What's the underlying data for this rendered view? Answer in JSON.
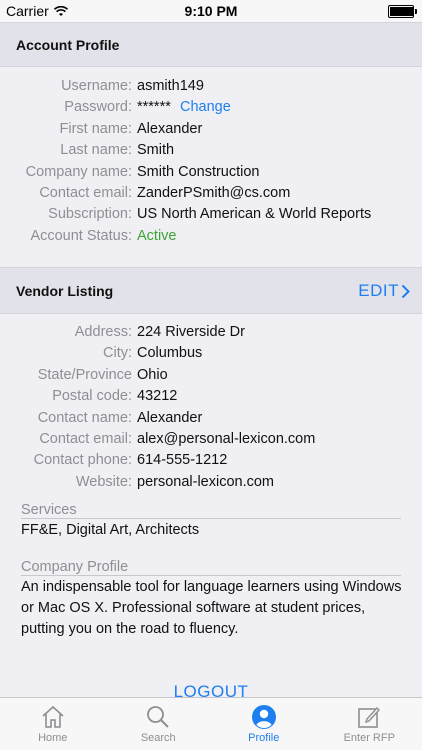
{
  "status_bar": {
    "carrier": "Carrier",
    "time": "9:10 PM",
    "battery_level": 0.95
  },
  "account_profile": {
    "title": "Account Profile",
    "fields": [
      {
        "label": "Username:",
        "value": "asmith149"
      },
      {
        "label": "Password:",
        "value": "******",
        "action": "Change"
      },
      {
        "label": "First name:",
        "value": "Alexander"
      },
      {
        "label": "Last name:",
        "value": "Smith"
      },
      {
        "label": "Company name:",
        "value": "Smith Construction"
      },
      {
        "label": "Contact email:",
        "value": "ZanderPSmith@cs.com"
      },
      {
        "label": "Subscription:",
        "value": "US North American & World Reports"
      },
      {
        "label": "Account Status:",
        "value": "Active"
      }
    ]
  },
  "vendor_listing": {
    "title": "Vendor Listing",
    "edit_label": "EDIT",
    "fields": [
      {
        "label": "Address:",
        "value": "224 Riverside Dr"
      },
      {
        "label": "City:",
        "value": "Columbus"
      },
      {
        "label": "State/Province",
        "value": "Ohio"
      },
      {
        "label": "Postal code:",
        "value": "43212"
      },
      {
        "label": "Contact name:",
        "value": "Alexander"
      },
      {
        "label": "Contact email:",
        "value": "alex@personal-lexicon.com"
      },
      {
        "label": "Contact phone:",
        "value": "614-555-1212"
      },
      {
        "label": "Website:",
        "value": "personal-lexicon.com"
      }
    ],
    "services_label": "Services",
    "services_value": "FF&E, Digital Art, Architects",
    "company_profile_label": "Company Profile",
    "company_profile_value": "An indispensable tool for language learners using Windows or Mac OS X. Professional software at student prices, putting you on the road to fluency."
  },
  "logout_label": "LOGOUT",
  "tabs": [
    {
      "label": "Home",
      "icon": "home-icon"
    },
    {
      "label": "Search",
      "icon": "search-icon"
    },
    {
      "label": "Profile",
      "icon": "profile-icon",
      "selected": true
    },
    {
      "label": "Enter RFP",
      "icon": "compose-icon"
    }
  ],
  "colors": {
    "accent": "#1e7ff0",
    "active_status": "#3ea335",
    "label_gray": "#8e8e93",
    "section_bg": "#e2e3ea"
  }
}
